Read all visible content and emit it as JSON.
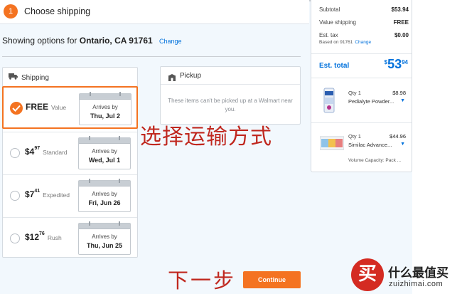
{
  "header": {
    "step_number": "1",
    "step_title": "Choose shipping"
  },
  "location": {
    "prefix": "Showing options for",
    "place": "Ontario, CA 91761",
    "change": "Change"
  },
  "shipping": {
    "title": "Shipping",
    "options": [
      {
        "dollars": "FREE",
        "cents": "",
        "label": "Value",
        "arrives": "Arrives by",
        "date": "Thu, Jul 2",
        "selected": true
      },
      {
        "dollars": "$4",
        "cents": "97",
        "label": "Standard",
        "arrives": "Arrives by",
        "date": "Wed, Jul 1",
        "selected": false
      },
      {
        "dollars": "$7",
        "cents": "41",
        "label": "Expedited",
        "arrives": "Arrives by",
        "date": "Fri, Jun 26",
        "selected": false
      },
      {
        "dollars": "$12",
        "cents": "76",
        "label": "Rush",
        "arrives": "Arrives by",
        "date": "Thu, Jun 25",
        "selected": false
      }
    ]
  },
  "pickup": {
    "title": "Pickup",
    "message": "These items can't be picked up at a Walmart near you."
  },
  "annotations": {
    "choose_shipping": "选择运输方式",
    "next_step": "下一步"
  },
  "continue_label": "Continue",
  "summary": {
    "subtotal_label": "Subtotal",
    "subtotal_value": "$53.94",
    "shipping_label": "Value shipping",
    "shipping_value": "FREE",
    "tax_label": "Est. tax",
    "tax_value": "$0.00",
    "based_on": "Based on 91761",
    "change": "Change",
    "total_label": "Est. total",
    "total_currency": "$",
    "total_whole": "53",
    "total_cents": "94",
    "items": [
      {
        "qty": "Qty 1",
        "price": "$8.98",
        "name": "Pedialyte Powder...",
        "thumb": "pedialyte-thumbnail"
      },
      {
        "qty": "Qty 1",
        "price": "$44.96",
        "name": "Similac Advance...",
        "variant": "Volume Capacity: Pack ...",
        "thumb": "similac-thumbnail"
      }
    ]
  },
  "watermark": {
    "logo_char": "买",
    "title": "什么最值买",
    "url": "zuizhimai.com"
  },
  "colors": {
    "accent": "#f47321",
    "link": "#0071dc",
    "annotation": "#c0281f"
  }
}
